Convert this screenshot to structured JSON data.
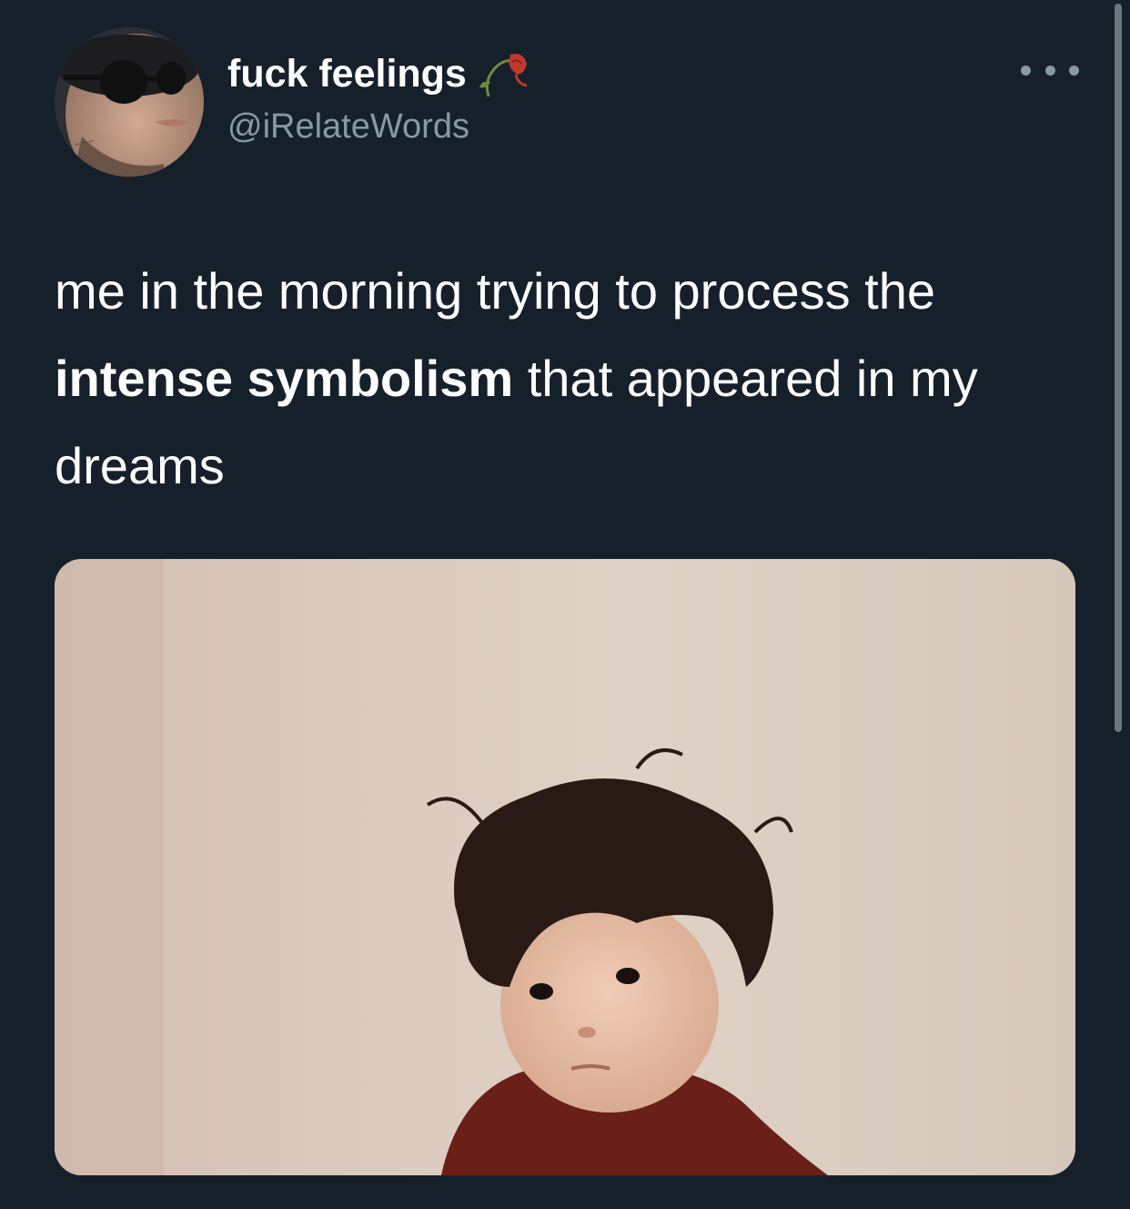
{
  "tweet": {
    "display_name": "fuck feelings",
    "name_emoji_icon": "wilted-rose-icon",
    "handle": "@iRelateWords",
    "more_icon": "more-horizontal-icon",
    "text_part1": "me in the morning trying to process the ",
    "text_bold": "intense symbolism",
    "text_part2": " that appeared in my dreams",
    "media_icon": "photo-child-icon"
  },
  "colors": {
    "background": "#15202b",
    "primary_text": "#ffffff",
    "secondary_text": "#8899a6",
    "scrollbar": "#6e767d"
  }
}
